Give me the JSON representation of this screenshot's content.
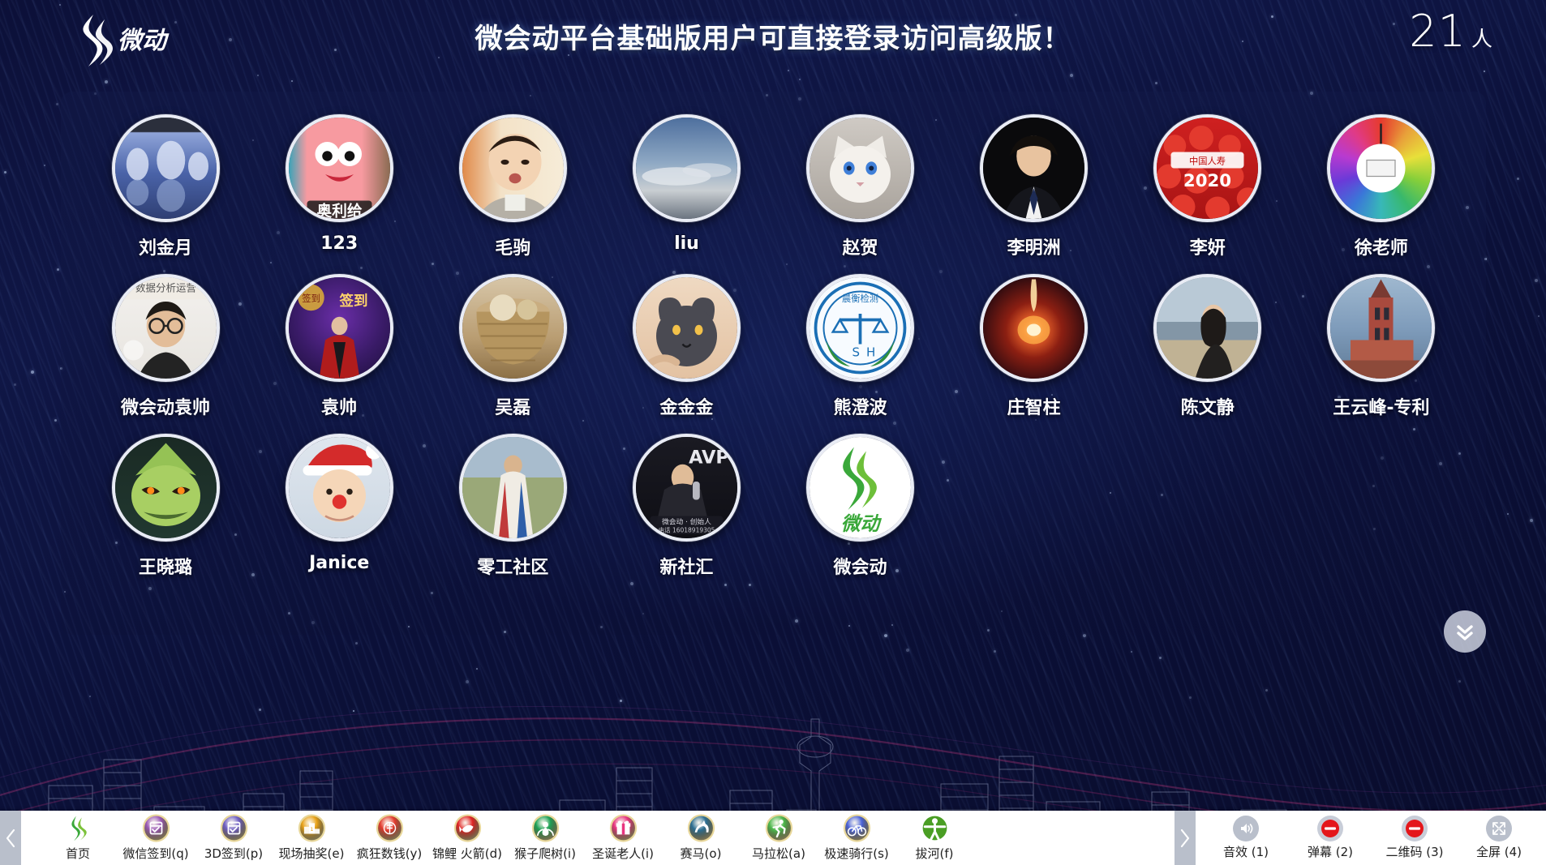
{
  "header": {
    "logo_icon": "weihuidong-logo-icon",
    "title": "微会动平台基础版用户可直接登录访问高级版！",
    "count": "21",
    "count_unit": "人"
  },
  "participants": [
    {
      "name": "刘金月",
      "art": "winter-lake"
    },
    {
      "name": "123",
      "art": "patrick-star"
    },
    {
      "name": "毛驹",
      "art": "toddler-boy"
    },
    {
      "name": "liu",
      "art": "sky-clouds"
    },
    {
      "name": "赵贺",
      "art": "white-cat"
    },
    {
      "name": "李明洲",
      "art": "man-suit"
    },
    {
      "name": "李妍",
      "art": "red-balloons"
    },
    {
      "name": "徐老师",
      "art": "color-wheel"
    },
    {
      "name": "微会动袁帅",
      "art": "man-glasses"
    },
    {
      "name": "袁帅",
      "art": "stage-purple"
    },
    {
      "name": "吴磊",
      "art": "basket-yarn"
    },
    {
      "name": "金金金",
      "art": "cat-paw"
    },
    {
      "name": "熊澄波",
      "art": "scale-emblem"
    },
    {
      "name": "庄智柱",
      "art": "fire-orb"
    },
    {
      "name": "陈文静",
      "art": "beach-woman"
    },
    {
      "name": "王云峰-专利",
      "art": "church-tower"
    },
    {
      "name": "王晓璐",
      "art": "green-monster"
    },
    {
      "name": "Janice",
      "art": "santa-baby"
    },
    {
      "name": "零工社区",
      "art": "grassland-person"
    },
    {
      "name": "新社汇",
      "art": "speaker-dark"
    },
    {
      "name": "微会动",
      "art": "weihuidong-logo"
    }
  ],
  "panel": {
    "collapse_icon": "chevron-double-down-icon"
  },
  "toolbar": {
    "prev_icon": "chevron-left-icon",
    "next_icon": "chevron-right-icon",
    "tools": [
      {
        "label": "首页",
        "icon": "home-logo-icon",
        "color": "#4caa2a"
      },
      {
        "label": "微信签到(q)",
        "icon": "calendar-check-icon",
        "color": "#9b59b6"
      },
      {
        "label": "3D签到(p)",
        "icon": "calendar-3d-icon",
        "color": "#6f5fc4"
      },
      {
        "label": "现场抽奖(e)",
        "icon": "podium-icon",
        "color": "#e8a117"
      },
      {
        "label": "疯狂数钱(y)",
        "icon": "money-icon",
        "color": "#e33b2e"
      },
      {
        "label": "锦鲤 火箭(d)",
        "icon": "koi-fish-icon",
        "color": "#e02323"
      },
      {
        "label": "猴子爬树(i)",
        "icon": "monkey-icon",
        "color": "#1ea155"
      },
      {
        "label": "圣诞老人(i)",
        "icon": "gift-icon",
        "color": "#e8357f"
      },
      {
        "label": "赛马(o)",
        "icon": "horse-icon",
        "color": "#2d6e91"
      },
      {
        "label": "马拉松(a)",
        "icon": "runner-icon",
        "color": "#4cb84c"
      },
      {
        "label": "极速骑行(s)",
        "icon": "bicycle-icon",
        "color": "#4b63d8"
      },
      {
        "label": "拔河(f)",
        "icon": "tug-of-war-icon",
        "color": "#4a9e24"
      }
    ],
    "system": [
      {
        "label": "音效 (1)",
        "icon": "sound-on-icon",
        "state": "grey"
      },
      {
        "label": "弹幕 (2)",
        "icon": "minus-red-icon",
        "state": "red"
      },
      {
        "label": "二维码 (3)",
        "icon": "minus-red-icon",
        "state": "red"
      },
      {
        "label": "全屏 (4)",
        "icon": "fullscreen-icon",
        "state": "grey"
      }
    ]
  },
  "colors": {
    "bg_deep": "#0a0d30",
    "bg_mid": "#101747",
    "accent_pink": "#e0408a",
    "toolbar_bg": "#ffffff",
    "avatar_ring": "#e9ecf5"
  }
}
